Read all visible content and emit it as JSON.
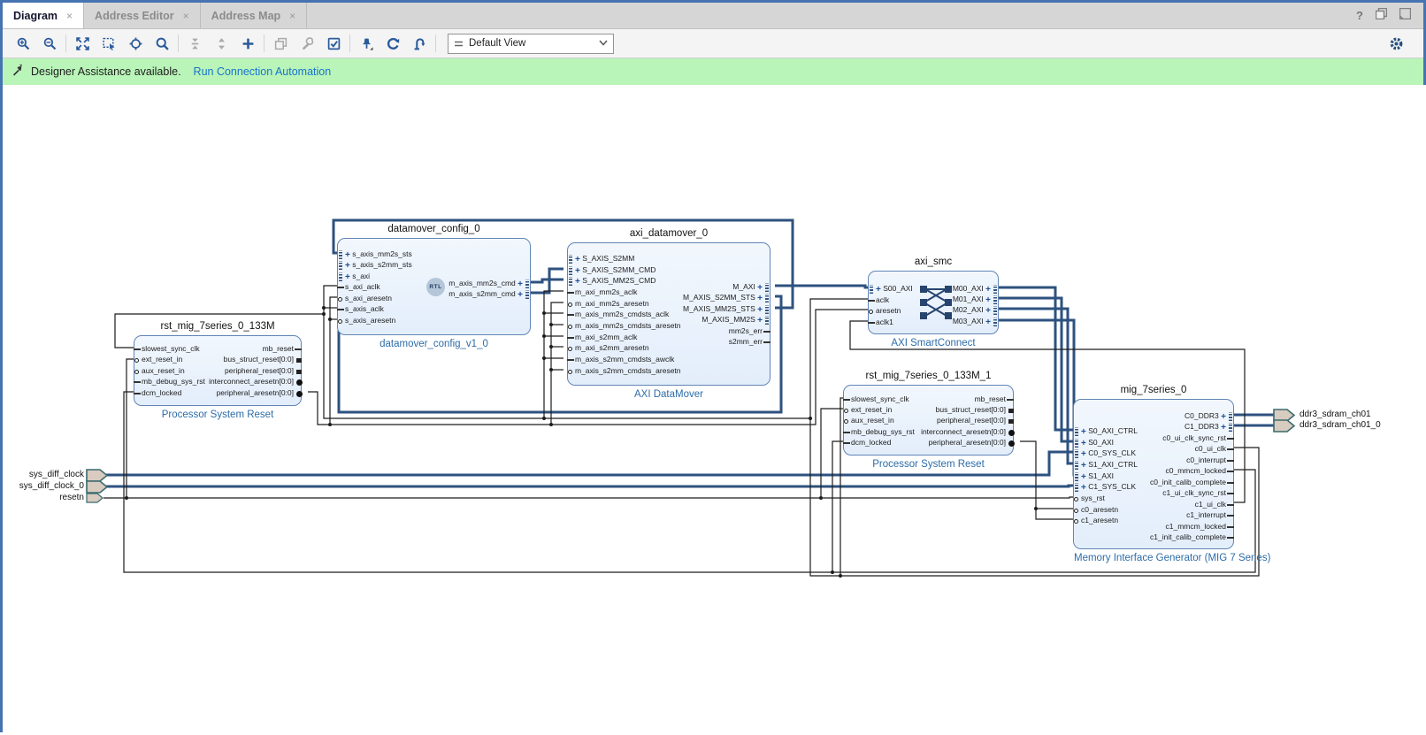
{
  "tabs": [
    {
      "label": "Diagram",
      "close": "×",
      "active": true
    },
    {
      "label": "Address Editor",
      "close": "×",
      "active": false
    },
    {
      "label": "Address Map",
      "close": "×",
      "active": false
    }
  ],
  "window_controls": {
    "help": "?"
  },
  "toolbar": {
    "icons": [
      {
        "id": "zoom-in",
        "enabled": true
      },
      {
        "id": "zoom-out",
        "enabled": true
      },
      {
        "id": "zoom-fit",
        "enabled": true
      },
      {
        "id": "zoom-to-selection",
        "enabled": true
      },
      {
        "id": "fit-view",
        "enabled": true
      },
      {
        "id": "search",
        "enabled": true
      },
      {
        "id": "collapse-hierarchy",
        "enabled": false
      },
      {
        "id": "expand-hierarchy",
        "enabled": false
      },
      {
        "id": "add-ip",
        "enabled": true
      },
      {
        "id": "copy",
        "enabled": false
      },
      {
        "id": "customize",
        "enabled": false
      },
      {
        "id": "validate-design",
        "enabled": true
      },
      {
        "id": "pin",
        "enabled": true
      },
      {
        "id": "regenerate-layout",
        "enabled": true
      },
      {
        "id": "optimize-routing",
        "enabled": true
      }
    ],
    "view_selector": "Default View"
  },
  "banner": {
    "text": "Designer Assistance available.",
    "link": "Run Connection Automation"
  },
  "colors": {
    "accent_blue": "#2a5a9b",
    "wire_bus": "#2e527f",
    "wire_signal": "#1c1c1c",
    "block_fill": "#eaf2fc",
    "block_border": "#6285b5",
    "banner_green": "#b9f4b9",
    "link_blue": "#1873cc",
    "subtitle_blue": "#2d6ca8"
  },
  "diagram": {
    "blocks": [
      {
        "name": "rst_mig_7series_0_133M",
        "subtitle": "Processor System Reset",
        "left_ports": [
          {
            "label": "slowest_sync_clk",
            "type": "in"
          },
          {
            "label": "ext_reset_in",
            "type": "inb"
          },
          {
            "label": "aux_reset_in",
            "type": "inb"
          },
          {
            "label": "mb_debug_sys_rst",
            "type": "in"
          },
          {
            "label": "dcm_locked",
            "type": "in"
          }
        ],
        "right_ports": [
          {
            "label": "mb_reset",
            "type": "out"
          },
          {
            "label": "bus_struct_reset[0:0]",
            "type": "osq"
          },
          {
            "label": "peripheral_reset[0:0]",
            "type": "osq"
          },
          {
            "label": "interconnect_aresetn[0:0]",
            "type": "odot"
          },
          {
            "label": "peripheral_aresetn[0:0]",
            "type": "odot"
          }
        ]
      },
      {
        "name": "datamover_config_0",
        "subtitle": "datamover_config_v1_0",
        "badge": "RTL",
        "left_ports": [
          {
            "label": "s_axis_mm2s_sts",
            "type": "bus"
          },
          {
            "label": "s_axis_s2mm_sts",
            "type": "bus"
          },
          {
            "label": "s_axi",
            "type": "bus"
          },
          {
            "label": "s_axi_aclk",
            "type": "in"
          },
          {
            "label": "s_axi_aresetn",
            "type": "inb"
          },
          {
            "label": "s_axis_aclk",
            "type": "in"
          },
          {
            "label": "s_axis_aresetn",
            "type": "inb"
          }
        ],
        "right_ports": [
          {
            "label": "m_axis_mm2s_cmd",
            "type": "bus"
          },
          {
            "label": "m_axis_s2mm_cmd",
            "type": "bus"
          }
        ]
      },
      {
        "name": "axi_datamover_0",
        "subtitle": "AXI DataMover",
        "left_ports": [
          {
            "label": "S_AXIS_S2MM",
            "type": "bus"
          },
          {
            "label": "S_AXIS_S2MM_CMD",
            "type": "bus"
          },
          {
            "label": "S_AXIS_MM2S_CMD",
            "type": "bus"
          },
          {
            "label": "m_axi_mm2s_aclk",
            "type": "in"
          },
          {
            "label": "m_axi_mm2s_aresetn",
            "type": "inb"
          },
          {
            "label": "m_axis_mm2s_cmdsts_aclk",
            "type": "in"
          },
          {
            "label": "m_axis_mm2s_cmdsts_aresetn",
            "type": "inb"
          },
          {
            "label": "m_axi_s2mm_aclk",
            "type": "in"
          },
          {
            "label": "m_axi_s2mm_aresetn",
            "type": "inb"
          },
          {
            "label": "m_axis_s2mm_cmdsts_awclk",
            "type": "in"
          },
          {
            "label": "m_axis_s2mm_cmdsts_aresetn",
            "type": "inb"
          }
        ],
        "right_ports": [
          {
            "label": "M_AXI",
            "type": "bus"
          },
          {
            "label": "M_AXIS_S2MM_STS",
            "type": "bus"
          },
          {
            "label": "M_AXIS_MM2S_STS",
            "type": "bus"
          },
          {
            "label": "M_AXIS_MM2S",
            "type": "bus"
          },
          {
            "label": "mm2s_err",
            "type": "out"
          },
          {
            "label": "s2mm_err",
            "type": "out"
          }
        ]
      },
      {
        "name": "axi_smc",
        "subtitle": "AXI SmartConnect",
        "icon": "crossbar",
        "left_ports": [
          {
            "label": "S00_AXI",
            "type": "bus"
          },
          {
            "label": "aclk",
            "type": "in"
          },
          {
            "label": "aresetn",
            "type": "inb"
          },
          {
            "label": "aclk1",
            "type": "in"
          }
        ],
        "right_ports": [
          {
            "label": "M00_AXI",
            "type": "bus"
          },
          {
            "label": "M01_AXI",
            "type": "bus"
          },
          {
            "label": "M02_AXI",
            "type": "bus"
          },
          {
            "label": "M03_AXI",
            "type": "bus"
          }
        ]
      },
      {
        "name": "rst_mig_7series_0_133M_1",
        "subtitle": "Processor System Reset",
        "left_ports": [
          {
            "label": "slowest_sync_clk",
            "type": "in"
          },
          {
            "label": "ext_reset_in",
            "type": "inb"
          },
          {
            "label": "aux_reset_in",
            "type": "inb"
          },
          {
            "label": "mb_debug_sys_rst",
            "type": "in"
          },
          {
            "label": "dcm_locked",
            "type": "in"
          }
        ],
        "right_ports": [
          {
            "label": "mb_reset",
            "type": "out"
          },
          {
            "label": "bus_struct_reset[0:0]",
            "type": "osq"
          },
          {
            "label": "peripheral_reset[0:0]",
            "type": "osq"
          },
          {
            "label": "interconnect_aresetn[0:0]",
            "type": "odot"
          },
          {
            "label": "peripheral_aresetn[0:0]",
            "type": "odot"
          }
        ]
      },
      {
        "name": "mig_7series_0",
        "subtitle": "Memory Interface Generator (MIG 7 Series)",
        "left_ports": [
          {
            "label": "S0_AXI_CTRL",
            "type": "bus"
          },
          {
            "label": "S0_AXI",
            "type": "bus"
          },
          {
            "label": "C0_SYS_CLK",
            "type": "bus"
          },
          {
            "label": "S1_AXI_CTRL",
            "type": "bus"
          },
          {
            "label": "S1_AXI",
            "type": "bus"
          },
          {
            "label": "C1_SYS_CLK",
            "type": "bus"
          },
          {
            "label": "sys_rst",
            "type": "inb"
          },
          {
            "label": "c0_aresetn",
            "type": "inb"
          },
          {
            "label": "c1_aresetn",
            "type": "inb"
          }
        ],
        "right_ports": [
          {
            "label": "C0_DDR3",
            "type": "bus"
          },
          {
            "label": "C1_DDR3",
            "type": "bus"
          },
          {
            "label": "c0_ui_clk_sync_rst",
            "type": "out"
          },
          {
            "label": "c0_ui_clk",
            "type": "out"
          },
          {
            "label": "c0_interrupt",
            "type": "out"
          },
          {
            "label": "c0_mmcm_locked",
            "type": "out"
          },
          {
            "label": "c0_init_calib_complete",
            "type": "out"
          },
          {
            "label": "c1_ui_clk_sync_rst",
            "type": "out"
          },
          {
            "label": "c1_ui_clk",
            "type": "out"
          },
          {
            "label": "c1_interrupt",
            "type": "out"
          },
          {
            "label": "c1_mmcm_locked",
            "type": "out"
          },
          {
            "label": "c1_init_calib_complete",
            "type": "out"
          }
        ]
      }
    ],
    "external_ports": {
      "left": [
        {
          "label": "sys_diff_clock",
          "kind": "interface"
        },
        {
          "label": "sys_diff_clock_0",
          "kind": "interface"
        },
        {
          "label": "resetn",
          "kind": "signal"
        }
      ],
      "right": [
        {
          "label": "ddr3_sdram_ch01",
          "kind": "interface"
        },
        {
          "label": "ddr3_sdram_ch01_0",
          "kind": "interface"
        }
      ]
    }
  }
}
